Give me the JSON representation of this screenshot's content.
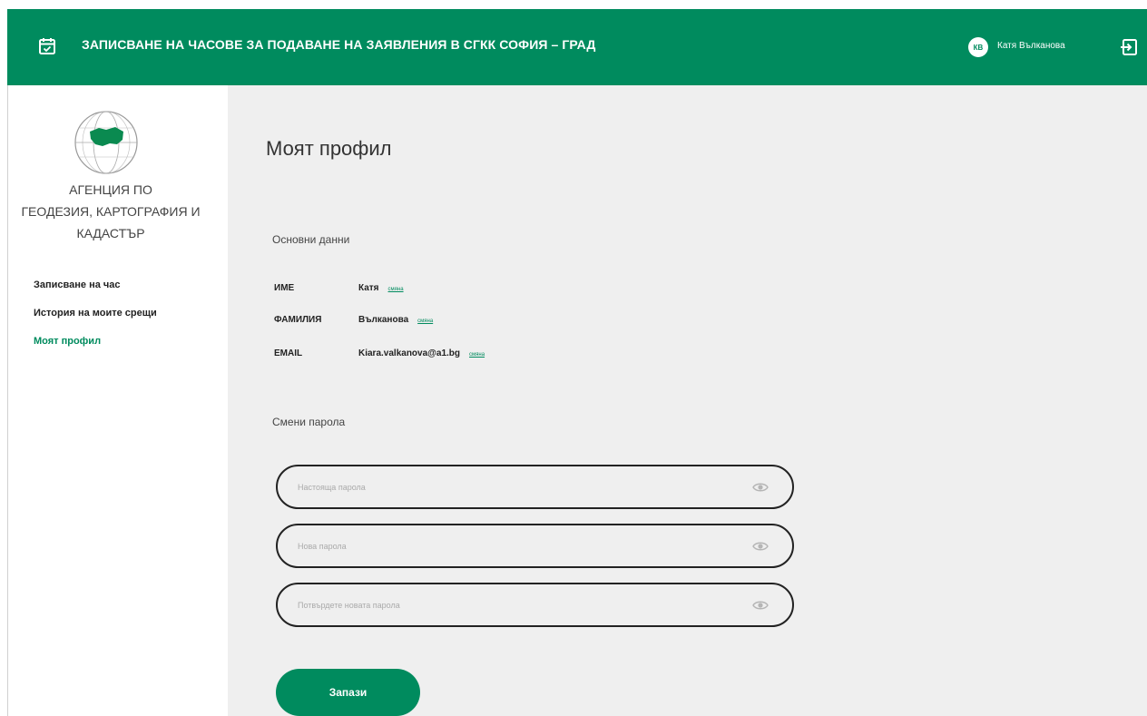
{
  "header": {
    "title": "ЗАПИСВАНЕ НА ЧАСОВЕ ЗА ПОДАВАНЕ НА ЗАЯВЛЕНИЯ В СГКК СОФИЯ – ГРАД",
    "calendar_icon": "calendar-check-icon",
    "user_initials": "КВ",
    "user_name": "Катя Вълканова",
    "logout_icon": "logout-icon"
  },
  "sidebar": {
    "logo_icon": "agency-globe-logo",
    "agency_lines": [
      "АГЕНЦИЯ ПО",
      "ГЕОДЕЗИЯ, КАРТОГРАФИЯ И",
      "КАДАСТЪР"
    ],
    "items": [
      {
        "label": "Записване на час",
        "active": false
      },
      {
        "label": "История на моите срещи",
        "active": false
      },
      {
        "label": "Моят профил",
        "active": true
      }
    ]
  },
  "main": {
    "title": "Моят профил",
    "basic_data": {
      "title": "Основни данни",
      "fields": [
        {
          "label": "ИМЕ",
          "value": "Катя",
          "change": "смяна"
        },
        {
          "label": "ФАМИЛИЯ",
          "value": "Вълканова",
          "change": "смяна"
        },
        {
          "label": "EMAIL",
          "value": "Kiara.valkanova@a1.bg",
          "change": "смяна"
        }
      ]
    },
    "password": {
      "title": "Смени парола",
      "current_placeholder": "Настояща парола",
      "new_placeholder": "Нова парола",
      "confirm_placeholder": "Потвърдете новата парола",
      "eye_icon": "eye-icon"
    },
    "save_label": "Запази"
  },
  "colors": {
    "brand": "#008b5e",
    "main_bg": "#efefef"
  }
}
